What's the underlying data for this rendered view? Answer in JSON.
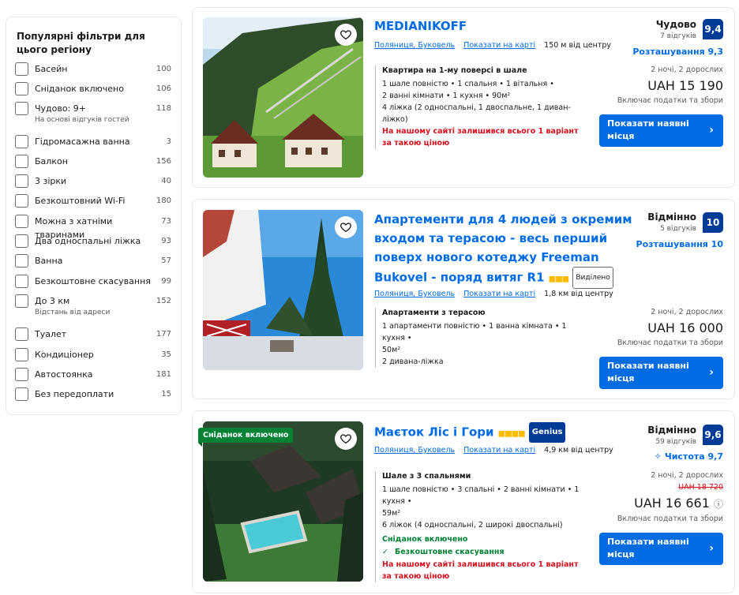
{
  "filters": {
    "title": "Популярні фільтри для цього регіону",
    "items": [
      {
        "label": "Басейн",
        "count": "100",
        "sub": ""
      },
      {
        "label": "Сніданок включено",
        "count": "106",
        "sub": ""
      },
      {
        "label": "Чудово: 9+",
        "count": "118",
        "sub": "На основі відгуків гостей"
      },
      {
        "label": "Гідромасажна ванна",
        "count": "3",
        "sub": ""
      },
      {
        "label": "Балкон",
        "count": "156",
        "sub": ""
      },
      {
        "label": "3 зірки",
        "count": "40",
        "sub": ""
      },
      {
        "label": "Безкоштовний Wi-Fi",
        "count": "180",
        "sub": ""
      },
      {
        "label": "Можна з хатніми тваринами",
        "count": "73",
        "sub": ""
      },
      {
        "label": "Два односпальні ліжка",
        "count": "93",
        "sub": ""
      },
      {
        "label": "Ванна",
        "count": "57",
        "sub": ""
      },
      {
        "label": "Безкоштовне скасування",
        "count": "99",
        "sub": ""
      },
      {
        "label": "До 3 км",
        "count": "152",
        "sub": "Відстань від адреси"
      },
      {
        "label": "Туалет",
        "count": "177",
        "sub": ""
      },
      {
        "label": "Кондиціонер",
        "count": "35",
        "sub": ""
      },
      {
        "label": "Автостоянка",
        "count": "181",
        "sub": ""
      },
      {
        "label": "Без передоплати",
        "count": "15",
        "sub": ""
      }
    ]
  },
  "cards": [
    {
      "title": "MEDIANIKOFF",
      "location": "Поляниця, Буковель",
      "show_on_map": "Показати на карті",
      "distance": "150 м від центру",
      "room_title": "Квартира на 1-му поверсі в шале",
      "lines": [
        "1 шале повністю • 1 спальня • 1 вітальня •",
        "2 ванні кімнати • 1 кухня • 90м²",
        "4 ліжка (2 односпальні, 1 двоспальне, 1 диван-ліжко)"
      ],
      "scarcity": "На нашому сайті залишився всього 1 варіант за такою ціною",
      "rating_word": "Чудово",
      "reviews": "7 відгуків",
      "score": "9,4",
      "location_score": "Розташування 9,3",
      "nights": "2 ночі, 2 дорослих",
      "price": "UAH 15 190",
      "taxes": "Включає податки та збори",
      "button": "Показати наявні місця"
    },
    {
      "title": "Апартементи для 4 людей з окремим входом та терасою - весь перший поверх нового котеджу Freeman Bukovel - поряд витяг R1",
      "tag": "Виділено",
      "location": "Поляниця, Буковель",
      "show_on_map": "Показати на карті",
      "distance": "1,8 км від центру",
      "room_title": "Апартаменти з терасою",
      "lines": [
        "1 апартаменти повністю • 1 ванна кімната • 1 кухня •",
        "50м²",
        "2 дивана-ліжка"
      ],
      "rating_word": "Відмінно",
      "reviews": "5 відгуків",
      "score": "10",
      "location_score": "Розташування 10",
      "nights": "2 ночі, 2 дорослих",
      "price": "UAH 16 000",
      "taxes": "Включає податки та збори",
      "button": "Показати наявні місця"
    },
    {
      "badge": "Сніданок включено",
      "title": "Маєток Ліс і Гори",
      "genius": "Genius",
      "location": "Поляниця, Буковель",
      "show_on_map": "Показати на карті",
      "distance": "4,9 км від центру",
      "room_title": "Шале з 3 спальнями",
      "lines": [
        "1 шале повністю • 3 спальні • 2 ванні кімнати • 1 кухня •",
        "59м²",
        "6 ліжок (4 односпальні, 2 широкі двоспальні)"
      ],
      "breakfast": "Сніданок включено",
      "free_cancel": "Безкоштовне скасування",
      "scarcity": "На нашому сайті залишився всього 1 варіант за такою ціною",
      "rating_word": "Відмінно",
      "reviews": "59 відгуків",
      "score": "9,6",
      "location_score": "Чистота 9,7",
      "nights": "2 ночі, 2 дорослих",
      "old_price": "UAH 18 720",
      "price": "UAH 16 661",
      "taxes": "Включає податки та збори",
      "button": "Показати наявні місця"
    }
  ],
  "colors": {
    "brand_blue": "#006ce4",
    "score_navy": "#003b95",
    "red": "#d4111e",
    "green": "#008234",
    "star": "#febb02"
  }
}
